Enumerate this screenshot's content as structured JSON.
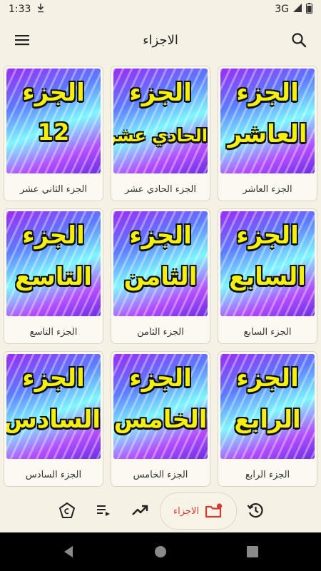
{
  "status_bar": {
    "time": "1:33",
    "network": "3G"
  },
  "app_bar": {
    "title": "الاجزاء"
  },
  "cards": [
    {
      "line1": "الجزء",
      "line2": "العاشر",
      "caption": "الجزء العاشر"
    },
    {
      "line1": "الجزء",
      "line2": "الحادي عشر",
      "caption": "الجزء الحادي عشر"
    },
    {
      "line1": "الجزء",
      "line2": "12",
      "caption": "الجزء الثاني عشر"
    },
    {
      "line1": "الجزء",
      "line2": "السابع",
      "caption": "الجزء السابع"
    },
    {
      "line1": "الجزء",
      "line2": "الثامن",
      "caption": "الجزء الثامن"
    },
    {
      "line1": "الجزء",
      "line2": "التاسع",
      "caption": "الجزء التاسع"
    },
    {
      "line1": "الجزء",
      "line2": "الرابع",
      "caption": "الجزء الرابع"
    },
    {
      "line1": "الجزء",
      "line2": "الخامس",
      "caption": "الجزء الخامس"
    },
    {
      "line1": "الجزء",
      "line2": "السادس",
      "caption": "الجزء السادس"
    }
  ],
  "bottom_nav": {
    "active_label": "الاجزاء"
  },
  "colors": {
    "accent": "#d63a2e",
    "background": "#f5f1e4",
    "thumb_text": "#f3ef11"
  }
}
